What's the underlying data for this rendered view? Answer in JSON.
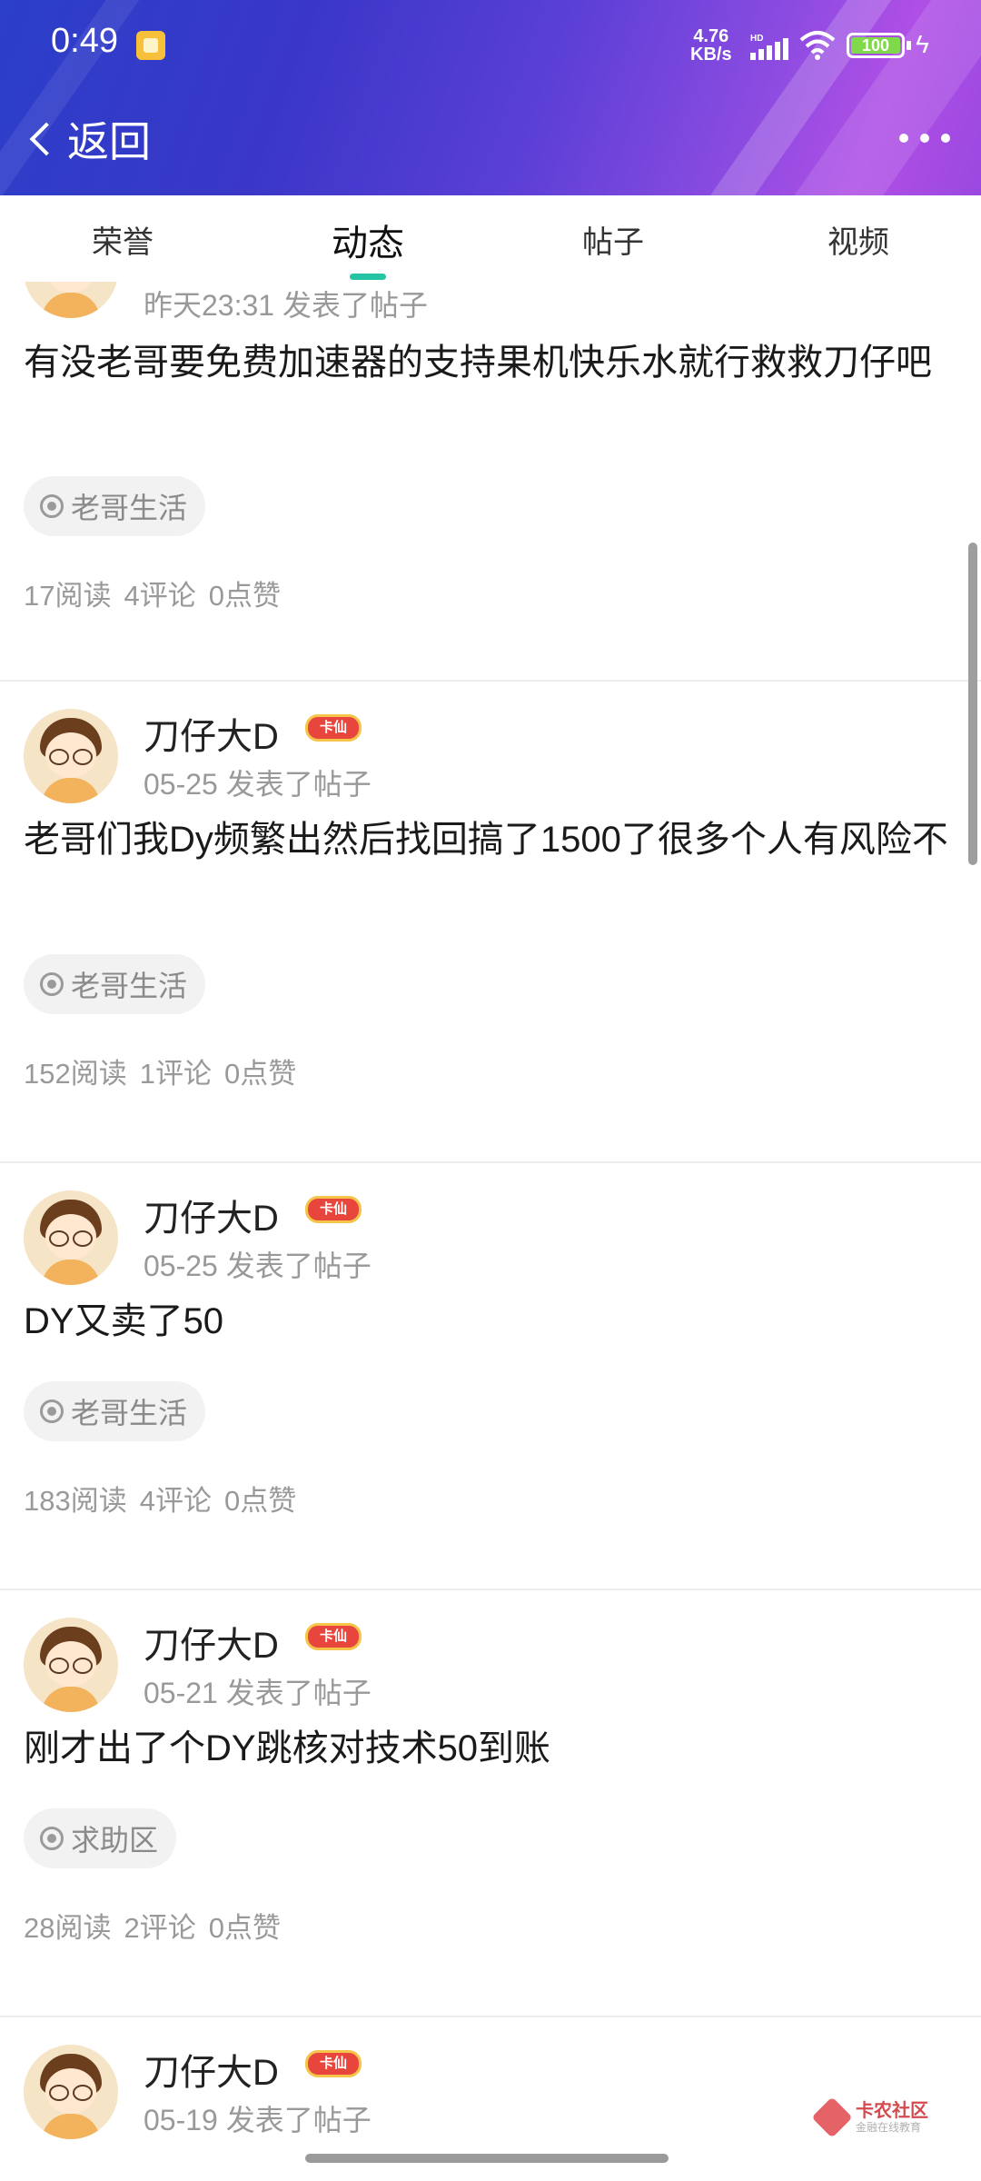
{
  "status_bar": {
    "time": "0:49",
    "net_speed_value": "4.76",
    "net_speed_unit": "KB/s",
    "net_type": "HD",
    "battery": "100"
  },
  "header": {
    "back_label": "返回"
  },
  "tabs": [
    {
      "label": "荣誉"
    },
    {
      "label": "动态"
    },
    {
      "label": "帖子"
    },
    {
      "label": "视频"
    }
  ],
  "active_tab": "动态",
  "posts": [
    {
      "username": "",
      "badge": "",
      "meta": "昨天23:31 发表了帖子",
      "content": "有没老哥要免费加速器的支持果机快乐水就行救救刀仔吧",
      "tag": "老哥生活",
      "stats": {
        "reads": "17阅读",
        "comments": "4评论",
        "likes": "0点赞"
      }
    },
    {
      "username": "刀仔大D",
      "badge": "卡仙",
      "meta": "05-25 发表了帖子",
      "content": "老哥们我Dy频繁出然后找回搞了1500了很多个人有风险不",
      "tag": "老哥生活",
      "stats": {
        "reads": "152阅读",
        "comments": "1评论",
        "likes": "0点赞"
      }
    },
    {
      "username": "刀仔大D",
      "badge": "卡仙",
      "meta": "05-25 发表了帖子",
      "content": "DY又卖了50",
      "tag": "老哥生活",
      "stats": {
        "reads": "183阅读",
        "comments": "4评论",
        "likes": "0点赞"
      }
    },
    {
      "username": "刀仔大D",
      "badge": "卡仙",
      "meta": "05-21 发表了帖子",
      "content": "刚才出了个DY跳核对技术50到账",
      "tag": "求助区",
      "stats": {
        "reads": "28阅读",
        "comments": "2评论",
        "likes": "0点赞"
      }
    },
    {
      "username": "刀仔大D",
      "badge": "卡仙",
      "meta": "05-19 发表了帖子"
    }
  ],
  "watermark": {
    "title": "卡农社区",
    "subtitle": "金融在线教育"
  }
}
